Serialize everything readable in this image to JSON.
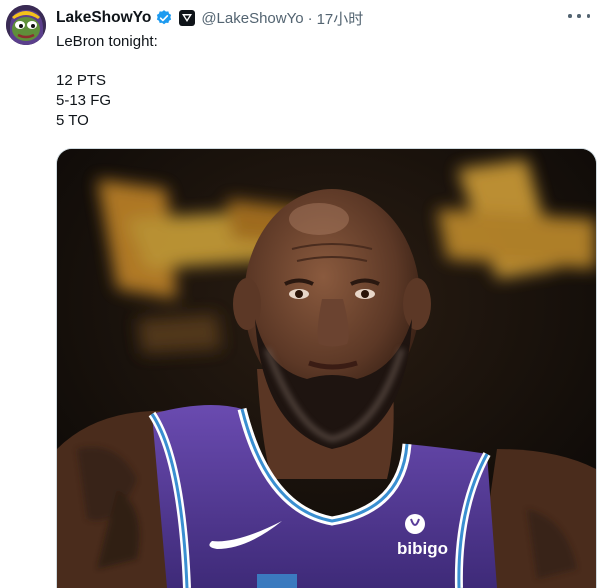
{
  "tweet": {
    "author": {
      "display_name": "LakeShowYo",
      "handle": "@LakeShowYo",
      "verified": true,
      "avatar_icon": "pepe-frog-avatar"
    },
    "timestamp": "17小时",
    "separator": "·",
    "text_lines": [
      "LeBron tonight:",
      "",
      "12 PTS",
      "5-13 FG",
      "5 TO"
    ],
    "media": {
      "image": "basketball-player-photo",
      "jersey_text": "bibigo"
    }
  },
  "colors": {
    "verified_blue": "#1d9bf0",
    "text_secondary": "#536471",
    "jersey_purple": "#5a3e9a",
    "background_gold": "#d4a73a"
  }
}
